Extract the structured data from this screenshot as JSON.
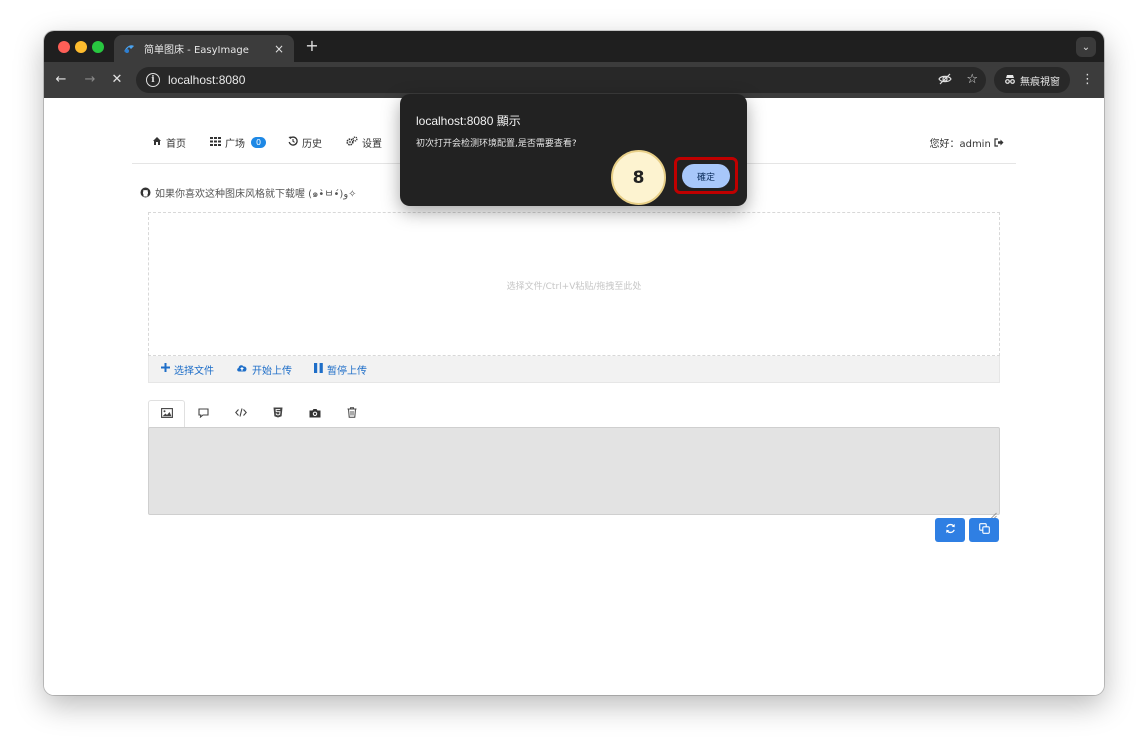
{
  "browser": {
    "tab_title": "简单图床 - EasyImage",
    "tab_close": "×",
    "new_tab": "+",
    "url": "localhost:8080",
    "incognito_label": "無痕視窗"
  },
  "app": {
    "nav": {
      "home": "首页",
      "square": "广场",
      "square_count": "0",
      "history": "历史",
      "settings": "设置",
      "greeting": "您好：admin"
    },
    "promo_text": "如果你喜欢这种图床风格就下载喔 (๑•̀ㅂ•́)و✧",
    "dropzone_text": "选择文件/Ctrl+V粘贴/拖拽至此处",
    "upload_actions": {
      "select": "选择文件",
      "start": "开始上传",
      "pause": "暂停上传"
    }
  },
  "dialog": {
    "title": "localhost:8080 顯示",
    "message": "初次打开会检测环境配置,是否需要查看?",
    "ok_label": "確定"
  },
  "annotation": {
    "step_number": "8",
    "highlight_color": "#c00000"
  },
  "colors": {
    "accent": "#2f7fe3",
    "badge": "#1e88e5",
    "link": "#1e6ec8"
  }
}
